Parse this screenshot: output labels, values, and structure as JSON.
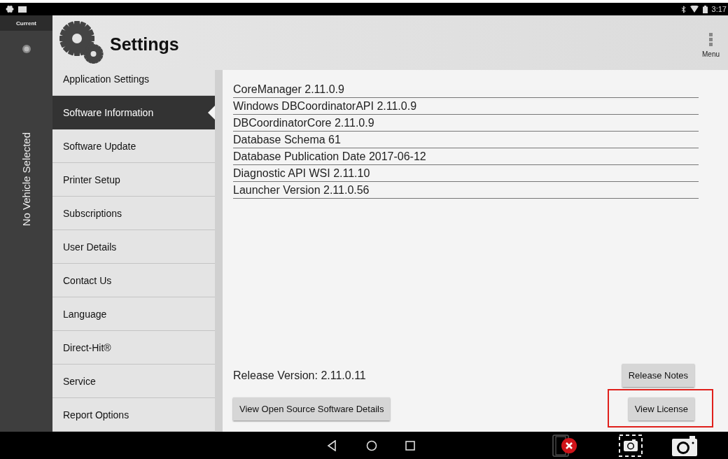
{
  "status_bar": {
    "time": "3:17"
  },
  "rail": {
    "tab": "Current",
    "vehicle": "No Vehicle Selected"
  },
  "header": {
    "title": "Settings",
    "menu_label": "Menu"
  },
  "sidebar": {
    "items": [
      {
        "label": "Application Settings",
        "selected": false
      },
      {
        "label": "Software Information",
        "selected": true
      },
      {
        "label": "Software Update",
        "selected": false
      },
      {
        "label": "Printer Setup",
        "selected": false
      },
      {
        "label": "Subscriptions",
        "selected": false
      },
      {
        "label": "User Details",
        "selected": false
      },
      {
        "label": "Contact Us",
        "selected": false
      },
      {
        "label": "Language",
        "selected": false
      },
      {
        "label": "Direct-Hit®",
        "selected": false
      },
      {
        "label": "Service",
        "selected": false
      },
      {
        "label": "Report Options",
        "selected": false
      }
    ]
  },
  "info_rows": [
    "CoreManager 2.11.0.9",
    "Windows DBCoordinatorAPI 2.11.0.9",
    "DBCoordinatorCore 2.11.0.9",
    "Database Schema 61",
    "Database Publication Date 2017-06-12",
    "Diagnostic API WSI 2.11.10",
    "Launcher Version 2.11.0.56"
  ],
  "release_version": "Release Version: 2.11.0.11",
  "release_notes_button": {
    "label": "Release Notes"
  },
  "open_source_button": {
    "label": "View Open Source Software Details"
  },
  "license_button": {
    "label": "View License",
    "highlighted": true
  }
}
